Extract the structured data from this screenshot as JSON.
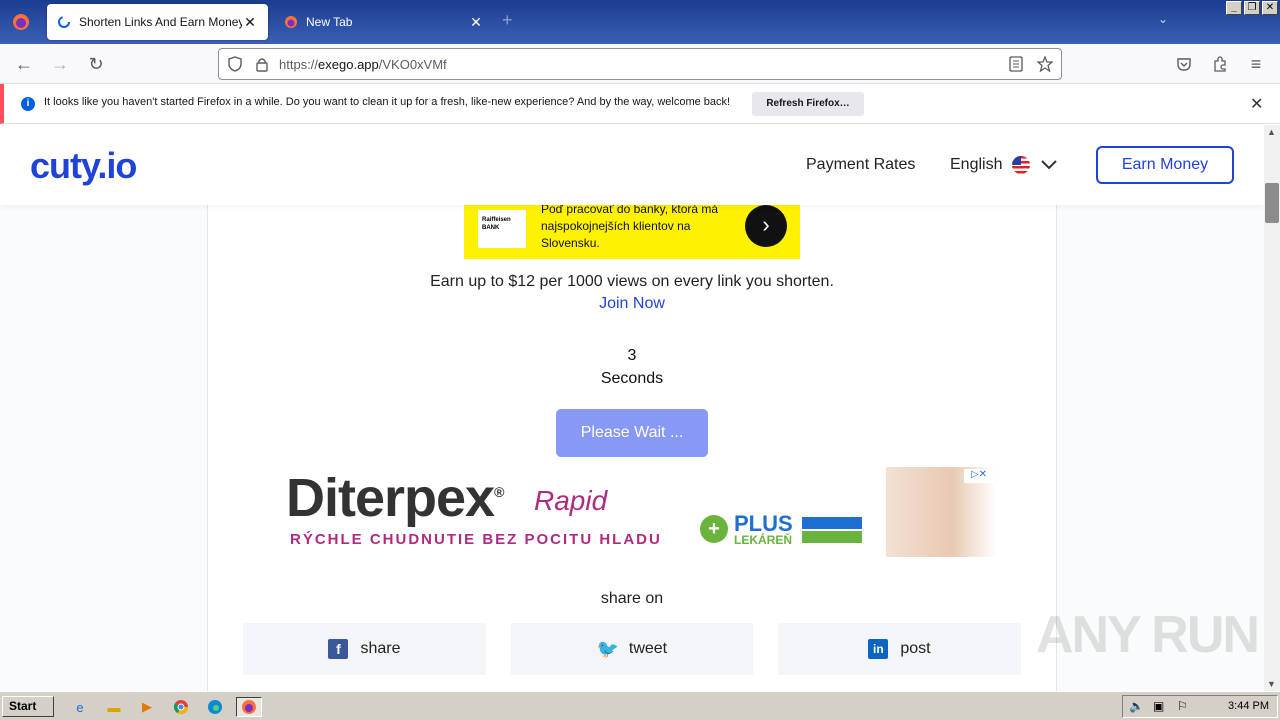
{
  "browser": {
    "tabs": [
      {
        "title": "Shorten Links And Earn Money | cu",
        "active": true
      },
      {
        "title": "New Tab",
        "active": false
      }
    ],
    "url_prefix": "https://",
    "url_host": "exego.app",
    "url_path": "/VKO0xVMf",
    "notification": {
      "message": "It looks like you haven't started Firefox in a while. Do you want to clean it up for a fresh, like-new experience? And by the way, welcome back!",
      "button": "Refresh Firefox…"
    }
  },
  "site": {
    "logo": "cuty.io",
    "nav_rates": "Payment Rates",
    "nav_lang": "English",
    "earn_button": "Earn Money"
  },
  "ad_top": {
    "bank": "Raiffeisen BANK",
    "text": "Poď pracovať do banky, ktorá má najspokojnejších klientov na Slovensku."
  },
  "main": {
    "earn_text": "Earn up to $12 per 1000 views on every link you shorten.",
    "join": "Join Now",
    "countdown": "3",
    "seconds_label": "Seconds",
    "wait_button": "Please Wait ..."
  },
  "ad_bottom": {
    "brand": "Diterpex",
    "reg": "®",
    "rapid": "Rapid",
    "tagline": "RÝCHLE CHUDNUTIE BEZ POCITU HLADU",
    "plus_top": "PLUS",
    "plus_bottom": "LEKÁREŇ",
    "adchoices": "▷✕"
  },
  "share": {
    "label": "share on",
    "buttons": [
      {
        "label": "share",
        "icon": "facebook-icon",
        "color": "#3b5998"
      },
      {
        "label": "tweet",
        "icon": "twitter-icon",
        "color": "#1da1f2"
      },
      {
        "label": "post",
        "icon": "linkedin-icon",
        "color": "#0a66c2"
      }
    ]
  },
  "watermark": "ANY RUN",
  "taskbar": {
    "start": "Start",
    "clock": "3:44 PM"
  }
}
